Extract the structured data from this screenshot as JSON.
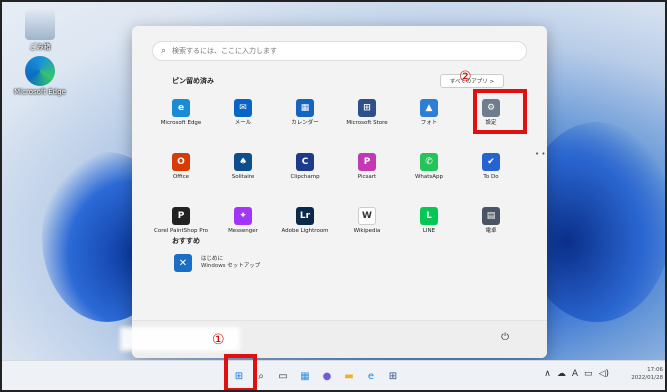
{
  "desktop": {
    "icons": [
      {
        "label": "ごみ箱",
        "icon": "recycle-bin-icon"
      },
      {
        "label": "Microsoft Edge",
        "icon": "edge-icon"
      }
    ]
  },
  "start_menu": {
    "search_placeholder": "検索するには、ここに入力します",
    "search_icon": "⌕",
    "pinned_title": "ピン留め済み",
    "all_apps_label": "すべてのアプリ  >",
    "pinned_apps": [
      {
        "label": "Microsoft Edge",
        "glyph": "e",
        "color": "#1a8bd6"
      },
      {
        "label": "メール",
        "glyph": "✉",
        "color": "#0a64c8"
      },
      {
        "label": "カレンダー",
        "glyph": "▦",
        "color": "#1565c0"
      },
      {
        "label": "Microsoft Store",
        "glyph": "⊞",
        "color": "#2f4f8a"
      },
      {
        "label": "フォト",
        "glyph": "▲",
        "color": "#2c7fd4"
      },
      {
        "label": "設定",
        "glyph": "⚙",
        "color": "#6f7c8c"
      },
      {
        "label": "Office",
        "glyph": "O",
        "color": "#d83b01"
      },
      {
        "label": "Solitaire",
        "glyph": "♠",
        "color": "#0d4f8c"
      },
      {
        "label": "Clipchamp",
        "glyph": "C",
        "color": "#1e3a8a"
      },
      {
        "label": "Picsart",
        "glyph": "P",
        "color": "#c239b3"
      },
      {
        "label": "WhatsApp",
        "glyph": "✆",
        "color": "#25c45b"
      },
      {
        "label": "To Do",
        "glyph": "✔",
        "color": "#2564cf"
      },
      {
        "label": "Corel PaintShop Pro",
        "glyph": "P",
        "color": "#222222"
      },
      {
        "label": "Messenger",
        "glyph": "✦",
        "color": "#a334fa"
      },
      {
        "label": "Adobe Lightroom",
        "glyph": "Lr",
        "color": "#0b2a4a"
      },
      {
        "label": "Wikipedia",
        "glyph": "W",
        "color": "#ffffff"
      },
      {
        "label": "LINE",
        "glyph": "L",
        "color": "#06c755"
      },
      {
        "label": "電卓",
        "glyph": "▤",
        "color": "#4a5563"
      }
    ],
    "recommended_title": "おすすめ",
    "recommended_item": {
      "line1": "はじめに",
      "line2": "Windows セットアップ",
      "glyph": "✕"
    },
    "power_glyph": "⏻"
  },
  "annotations": {
    "marker1": "①",
    "marker2": "②"
  },
  "taskbar": {
    "items": [
      {
        "name": "start-button",
        "glyph": "⊞",
        "color": "#1677e0"
      },
      {
        "name": "search-icon",
        "glyph": "⌕",
        "color": "#333333"
      },
      {
        "name": "task-view-icon",
        "glyph": "▭",
        "color": "#333333"
      },
      {
        "name": "widgets-icon",
        "glyph": "▦",
        "color": "#2f8de4"
      },
      {
        "name": "chat-icon",
        "glyph": "●",
        "color": "#6b5fd3"
      },
      {
        "name": "file-explorer-icon",
        "glyph": "▬",
        "color": "#f2b01e"
      },
      {
        "name": "edge-icon",
        "glyph": "e",
        "color": "#1a8bd6"
      },
      {
        "name": "store-icon",
        "glyph": "⊞",
        "color": "#2f4f8a"
      }
    ],
    "tray": [
      "∧",
      "☁",
      "A",
      "▭",
      "◁)"
    ],
    "time": "17:06",
    "date": "2022/01/28"
  }
}
